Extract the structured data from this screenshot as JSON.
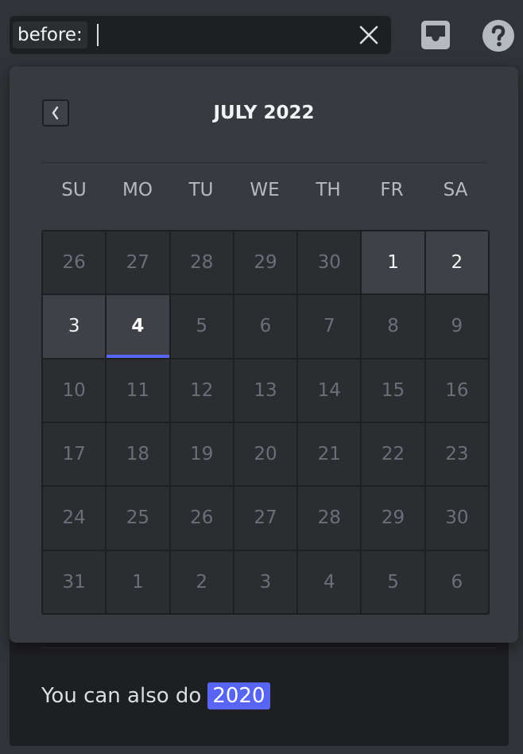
{
  "search": {
    "token": "before:",
    "value": "",
    "placeholder": ""
  },
  "calendar": {
    "month_title": "JULY 2022",
    "weekdays": [
      "SU",
      "MO",
      "TU",
      "WE",
      "TH",
      "FR",
      "SA"
    ],
    "days": [
      [
        "26",
        "27",
        "28",
        "29",
        "30",
        "1",
        "2"
      ],
      [
        "3",
        "4",
        "5",
        "6",
        "7",
        "8",
        "9"
      ],
      [
        "10",
        "11",
        "12",
        "13",
        "14",
        "15",
        "16"
      ],
      [
        "17",
        "18",
        "19",
        "20",
        "21",
        "22",
        "23"
      ],
      [
        "24",
        "25",
        "26",
        "27",
        "28",
        "29",
        "30"
      ],
      [
        "31",
        "1",
        "2",
        "3",
        "4",
        "5",
        "6"
      ]
    ],
    "selected_day": "4"
  },
  "hint": {
    "text": "You can also do",
    "badge": "2020"
  },
  "colors": {
    "accent": "#5865f2",
    "popout_bg": "#383a40",
    "cell_bg": "#2b2d31",
    "page_bg": "#313338"
  },
  "icons": {
    "clear": "close-icon",
    "inbox": "inbox-icon",
    "help": "help-icon",
    "prev": "chevron-left-icon"
  }
}
